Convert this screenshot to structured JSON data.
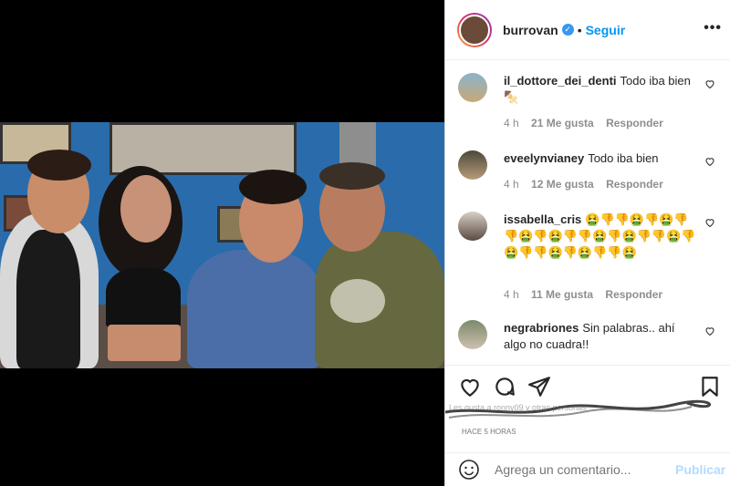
{
  "header": {
    "username": "burrovan",
    "verified_icon": "verified-badge-icon",
    "separator": "•",
    "follow_label": "Seguir",
    "more_label": "•••"
  },
  "comments": [
    {
      "user": "il_dottore_dei_denti",
      "text": "Todo iba bien 🍢",
      "time": "4 h",
      "likes": "21 Me gusta",
      "reply": "Responder"
    },
    {
      "user": "eveelynvianey",
      "text": "Todo iba bien",
      "time": "4 h",
      "likes": "12 Me gusta",
      "reply": "Responder"
    },
    {
      "user": "issabella_cris",
      "text": "🤮👎👎🤮👎🤮👎👎🤮👎🤮👎👎🤮👎🤮👎👎🤮👎🤮👎👎🤮👎🤮👎👎🤮",
      "time": "4 h",
      "likes": "11 Me gusta",
      "reply": "Responder"
    },
    {
      "user": "negrabriones",
      "text": "Sin palabras.. ahí algo no cuadra!!"
    }
  ],
  "scribble": {
    "line1": "Les gusta a ronny09 y otras personas",
    "line2": "HACE 5 HORAS"
  },
  "add_comment": {
    "placeholder": "Agrega un comentario...",
    "post_label": "Publicar"
  },
  "colors": {
    "accent": "#0095f6",
    "post_disabled": "#b3dbff",
    "wall": "#2a6cab"
  }
}
